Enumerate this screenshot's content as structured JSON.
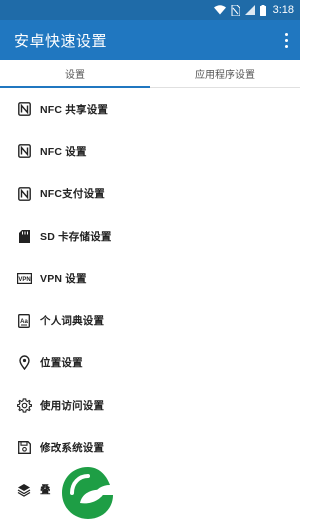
{
  "status_bar": {
    "time": "3:18",
    "icons": [
      "wifi-icon",
      "no-sim-icon",
      "signal-icon",
      "battery-icon"
    ]
  },
  "app_bar": {
    "title": "安卓快速设置",
    "overflow_icon": "more-vert-icon"
  },
  "tabs": [
    {
      "label": "设置",
      "active": true
    },
    {
      "label": "应用程序设置",
      "active": false
    }
  ],
  "settings_list": [
    {
      "label": "NFC 共享设置",
      "icon": "nfc-icon"
    },
    {
      "label": "NFC 设置",
      "icon": "nfc-icon"
    },
    {
      "label": "NFC支付设置",
      "icon": "nfc-icon"
    },
    {
      "label": "SD 卡存储设置",
      "icon": "sd-card-icon"
    },
    {
      "label": "VPN 设置",
      "icon": "vpn-icon"
    },
    {
      "label": "个人词典设置",
      "icon": "dictionary-icon"
    },
    {
      "label": "位置设置",
      "icon": "location-icon"
    },
    {
      "label": "使用访问设置",
      "icon": "gear-icon"
    },
    {
      "label": "修改系统设置",
      "icon": "save-icon"
    },
    {
      "label": "叠",
      "icon": "layers-icon"
    }
  ],
  "colors": {
    "status_bar": "#1f6ba8",
    "app_bar": "#2077c0",
    "tab_indicator": "#2077c0",
    "logo_green": "#1e9e45"
  }
}
